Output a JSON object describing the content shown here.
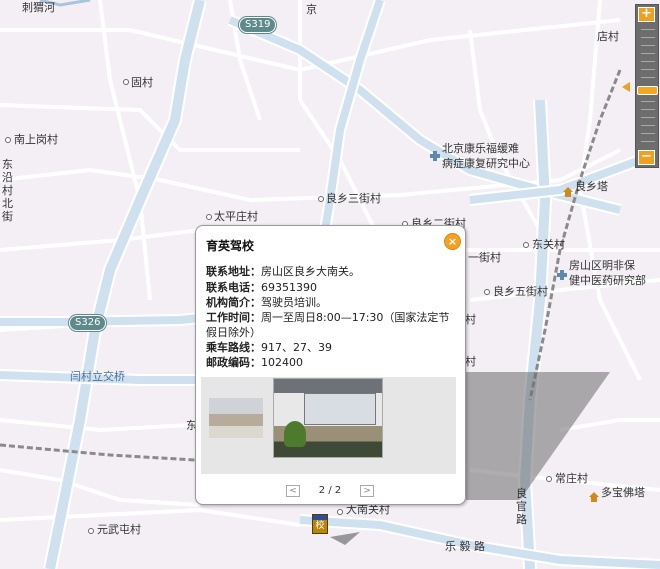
{
  "map": {
    "labels": {
      "l1": "刺猬河",
      "l2": "京",
      "l3": "店村",
      "l4": "固村",
      "l5": "南上岗村",
      "l6": "东 沿 村 北 街",
      "l7": "北京康乐福缓难",
      "l8": "病症康复研究中心",
      "l9": "良乡塔",
      "l10": "良乡三街村",
      "l11": "太平庄村",
      "l12": "良乡二街村",
      "l13": "东关村",
      "l14": "一街村",
      "l15": "房山区明非保",
      "l16": "健中医药研究部",
      "l17": "良乡五街村",
      "l18": "闫村立交桥",
      "l19": "常庄村",
      "l20": "多宝佛塔",
      "l21": "良 官 路",
      "l22": "大南关村",
      "l23": "元武屯村",
      "l24": "乐 毅 路",
      "l25": "村",
      "l26": "村",
      "l27": "东"
    },
    "shields": {
      "s319": "S319",
      "s326": "S326"
    },
    "marker_label": "校"
  },
  "zoom": {
    "in_label": "+",
    "out_label": "−",
    "level": 0.5
  },
  "popup": {
    "title": "育英驾校",
    "close_label": "×",
    "rows": [
      {
        "key": "联系地址：",
        "value": "房山区良乡大南关。"
      },
      {
        "key": "联系电话：",
        "value": "69351390"
      },
      {
        "key": "机构简介：",
        "value": "驾驶员培训。"
      },
      {
        "key": "工作时间：",
        "value": "周一至周日8:00—17:30（国家法定节假日除外）"
      },
      {
        "key": "乘车路线：",
        "value": "917、27、39"
      },
      {
        "key": "邮政编码：",
        "value": "102400"
      }
    ],
    "pager": {
      "prev": "<",
      "next": ">",
      "current": "2",
      "sep": "/",
      "total": "2"
    }
  },
  "colors": {
    "road_major": "#cfe0ef",
    "road_edge": "#ffffff",
    "accent": "#f1a227",
    "shield": "#5e8a8c"
  }
}
